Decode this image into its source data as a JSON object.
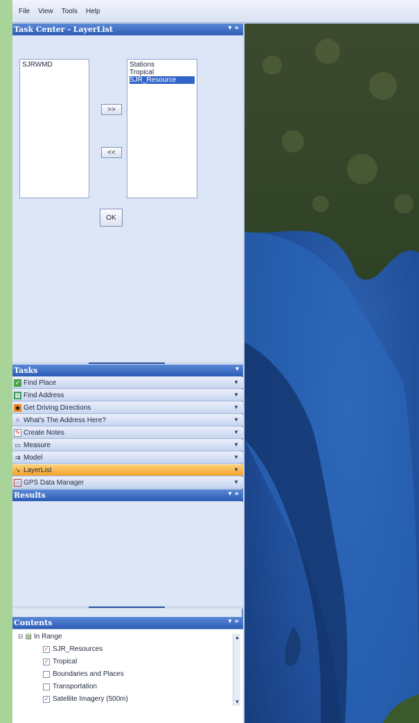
{
  "menu": [
    "File",
    "View",
    "Tools",
    "Help"
  ],
  "task_center": {
    "title": "Task Center - LayerList",
    "header_buttons": [
      "▾",
      "»"
    ],
    "available_layers": [
      "SJRWMD"
    ],
    "selected_layers": [
      "Stations",
      "Tropical",
      "SJR_Resource"
    ],
    "highlighted_index": 2,
    "add_label": ">>",
    "remove_label": "<<",
    "ok_label": "OK"
  },
  "tasks": {
    "title": "Tasks",
    "header_button": "▾",
    "items": [
      {
        "label": "Find Place",
        "icon": "find-place-icon"
      },
      {
        "label": "Find Address",
        "icon": "find-address-icon"
      },
      {
        "label": "Get Driving Directions",
        "icon": "driving-directions-icon"
      },
      {
        "label": "What's The Address Here?",
        "icon": "address-here-icon"
      },
      {
        "label": "Create Notes",
        "icon": "create-notes-icon"
      },
      {
        "label": "Measure",
        "icon": "measure-icon"
      },
      {
        "label": "Model",
        "icon": "model-icon"
      },
      {
        "label": "LayerList",
        "icon": "layerlist-icon",
        "active": true
      },
      {
        "label": "GPS Data Manager",
        "icon": "gps-data-icon"
      }
    ]
  },
  "results": {
    "title": "Results",
    "header_buttons": [
      "▾",
      "»"
    ]
  },
  "contents": {
    "title": "Contents",
    "header_buttons": [
      "▾",
      "»"
    ],
    "group": "In Range",
    "layers": [
      {
        "label": "SJR_Resources",
        "checked": true
      },
      {
        "label": "Tropical",
        "checked": true
      },
      {
        "label": "Boundaries and Places",
        "checked": false
      },
      {
        "label": "Transportation",
        "checked": false
      },
      {
        "label": "Satellite Imagery (500m)",
        "checked": true
      }
    ]
  },
  "colors": {
    "header_blue": "#2c5cb6",
    "active_task": "#f4a22c",
    "selection": "#3264c8",
    "land": "#3a4a2c",
    "water": "#1d4a8f"
  }
}
